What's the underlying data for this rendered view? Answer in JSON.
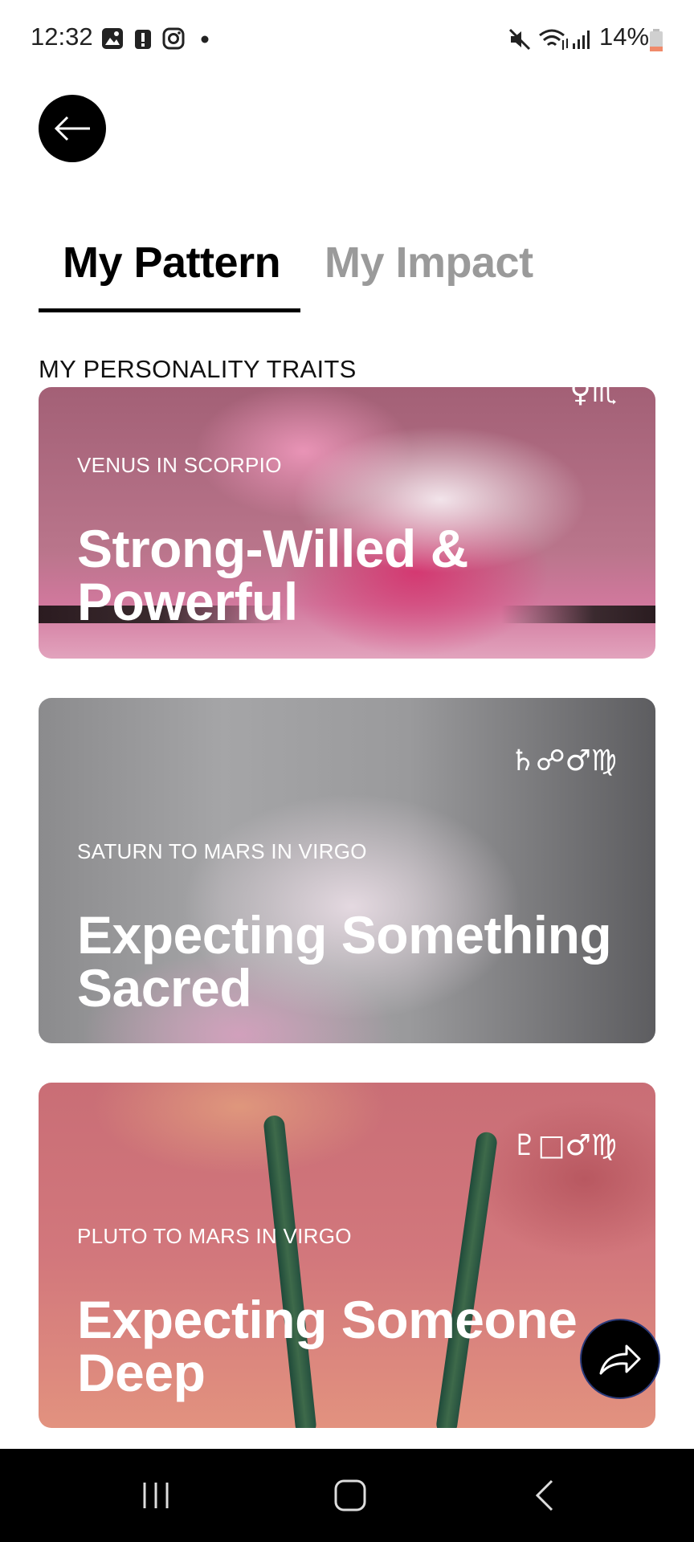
{
  "status_bar": {
    "time": "12:32",
    "battery": "14%",
    "icons": [
      "gallery-icon",
      "alert-icon",
      "instagram-icon",
      "dot-icon",
      "mute-icon",
      "wifi-icon",
      "signal-icon",
      "battery-icon"
    ]
  },
  "tabs": [
    {
      "label": "My Pattern",
      "active": true
    },
    {
      "label": "My Impact",
      "active": false
    }
  ],
  "section": {
    "title": "MY PERSONALITY TRAITS"
  },
  "cards": [
    {
      "subtitle": "VENUS IN SCORPIO",
      "title": "Strong-Willed & Powerful",
      "glyphs": "♀♏"
    },
    {
      "subtitle": "SATURN TO MARS IN VIRGO",
      "title": "Expecting Something Sacred",
      "glyphs": "♄☍♂♍"
    },
    {
      "subtitle": "PLUTO TO MARS IN VIRGO",
      "title": "Expecting Someone Deep",
      "glyphs": "♇□♂♍"
    }
  ],
  "colors": {
    "accent": "#000000",
    "inactive_tab": "#9a9a9a"
  }
}
